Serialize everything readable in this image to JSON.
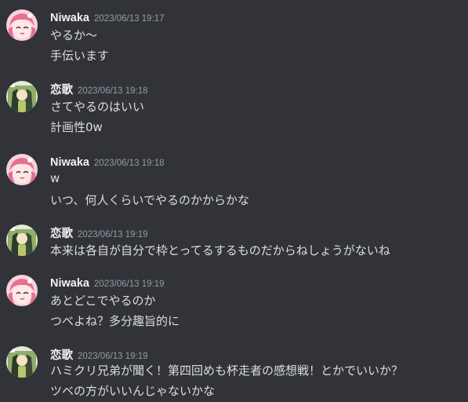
{
  "messages": [
    {
      "author": "Niwaka",
      "time": "2023/06/13 19:17",
      "avatar_icon": "pink-anime-avatar",
      "lines": [
        "やるか〜",
        "手伝います"
      ]
    },
    {
      "author": "恋歌",
      "time": "2023/06/13 19:18",
      "avatar_icon": "green-anime-avatar",
      "lines": [
        "さてやるのはいい",
        "計画性0w"
      ]
    },
    {
      "author": "Niwaka",
      "time": "2023/06/13 19:18",
      "avatar_icon": "pink-anime-avatar",
      "lines": [
        "w",
        "いつ、何人くらいでやるのかからかな"
      ]
    },
    {
      "author": "恋歌",
      "time": "2023/06/13 19:19",
      "avatar_icon": "green-anime-avatar",
      "lines": [
        "本来は各自が自分で枠とってるするものだからねしょうがないね"
      ]
    },
    {
      "author": "Niwaka",
      "time": "2023/06/13 19:19",
      "avatar_icon": "pink-anime-avatar",
      "lines": [
        "あとどこでやるのか",
        "つべよね？多分趣旨的に"
      ]
    },
    {
      "author": "恋歌",
      "time": "2023/06/13 19:19",
      "avatar_icon": "green-anime-avatar",
      "lines": [
        "ハミクリ兄弟が聞く！第四回めも杯走者の感想戦！とかでいいか？",
        "ツベの方がいいんじゃないかな"
      ]
    }
  ],
  "colors": {
    "background": "#313338",
    "username": "#f2f3f5",
    "timestamp": "#949ba4",
    "text": "#dbdee1"
  }
}
